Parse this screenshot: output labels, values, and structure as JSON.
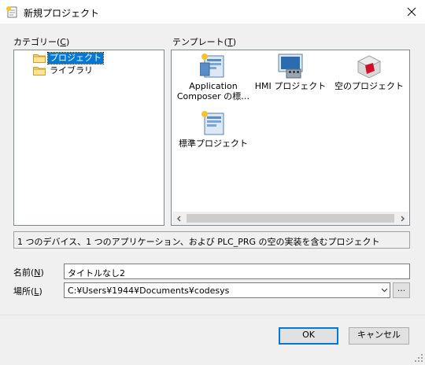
{
  "window": {
    "title": "新規プロジェクト",
    "close_icon": "close-icon",
    "app_icon": "new-project-icon"
  },
  "category": {
    "label": "カテゴリー(",
    "accel": "C",
    "label_end": ")",
    "items": [
      {
        "label": "プロジェクト",
        "icon": "folder-icon",
        "selected": true
      },
      {
        "label": "ライブラリ",
        "icon": "folder-icon",
        "selected": false
      }
    ]
  },
  "template": {
    "label": "テンプレート(",
    "accel": "T",
    "label_end": ")",
    "items": [
      {
        "line1": "Application",
        "line2": "Composer の標…",
        "icon": "application-composer-icon"
      },
      {
        "line1": "HMI プロジェクト",
        "line2": "",
        "icon": "hmi-project-icon"
      },
      {
        "line1": "空のプロジェクト",
        "line2": "",
        "icon": "empty-project-icon"
      },
      {
        "line1": "標準プロジェクト",
        "line2": "",
        "icon": "standard-project-icon"
      }
    ]
  },
  "description": "1 つのデバイス、1 つのアプリケーション、および PLC_PRG の空の実装を含むプロジェクト",
  "name_field": {
    "label": "名前(",
    "accel": "N",
    "label_end": ")",
    "value": "タイトルなし2"
  },
  "location_field": {
    "label": "場所(",
    "accel": "L",
    "label_end": ")",
    "value": "C:¥Users¥1944¥Documents¥codesys"
  },
  "browse_label": "...",
  "ok_label": "OK",
  "cancel_label": "キャンセル",
  "colors": {
    "accent": "#0078d7",
    "selection": "#0078d7",
    "window": "#f0f0f0"
  }
}
